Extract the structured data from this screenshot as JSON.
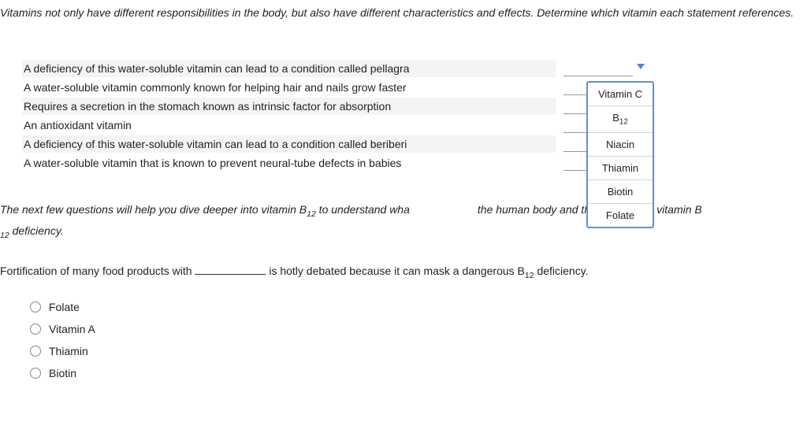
{
  "intro": "Vitamins not only have different responsibilities in the body, but also have different characteristics and effects. Determine which vitamin each statement references.",
  "statements": [
    "A deficiency of this water-soluble vitamin can lead to a condition called pellagra",
    "A water-soluble vitamin commonly known for helping hair and nails grow faster",
    "Requires a secretion in the stomach known as intrinsic factor for absorption",
    "An antioxidant vitamin",
    "A deficiency of this water-soluble vitamin can lead to a condition called beriberi",
    "A water-soluble vitamin that is known to prevent neural-tube defects in babies"
  ],
  "options": {
    "0": "Vitamin C",
    "1_html": "B<sub>12</sub>",
    "2": "Niacin",
    "3": "Thiamin",
    "4": "Biotin",
    "5": "Folate"
  },
  "para_pre": "The next few questions will help you dive deeper into vitamin B",
  "para_sub": "12",
  "para_mid": " to understand wha",
  "para_post": "the human body and the effects of a vitamin B",
  "para_sub2": "12",
  "para_end": " deficiency.",
  "q2_pre": "Fortification of many food products with ",
  "q2_post": " is hotly debated because it can mask a dangerous B",
  "q2_sub": "12",
  "q2_end": " deficiency.",
  "radios": [
    "Folate",
    "Vitamin A",
    "Thiamin",
    "Biotin"
  ]
}
